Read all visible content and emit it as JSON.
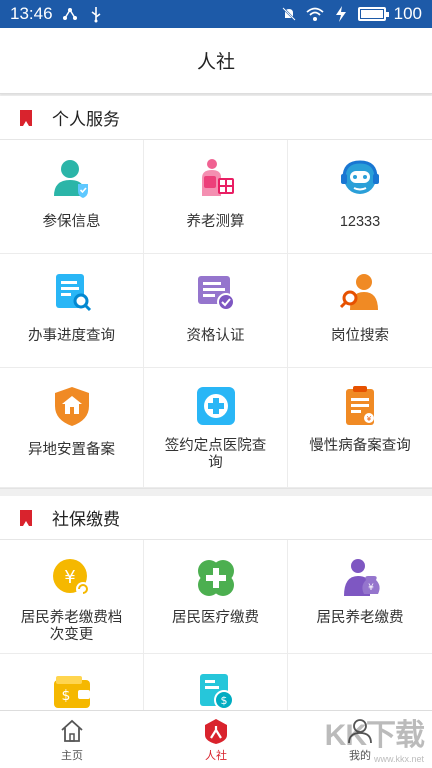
{
  "statusbar": {
    "time": "13:46",
    "battery_text": "100",
    "battery_level": 1.0
  },
  "header": {
    "title": "人社"
  },
  "personal": {
    "title": "个人服务",
    "items": [
      {
        "label": "参保信息",
        "icon": "insured-person-icon"
      },
      {
        "label": "养老测算",
        "icon": "pension-calculator-icon"
      },
      {
        "label": "12333",
        "icon": "hotline-robot-icon"
      },
      {
        "label": "办事进度查询",
        "icon": "progress-search-icon"
      },
      {
        "label": "资格认证",
        "icon": "qualification-verify-icon"
      },
      {
        "label": "岗位搜索",
        "icon": "job-search-icon"
      },
      {
        "label": "异地安置备案",
        "icon": "relocation-house-icon"
      },
      {
        "label": "签约定点医院查询",
        "icon": "hospital-cross-icon"
      },
      {
        "label": "慢性病备案查询",
        "icon": "chronic-clipboard-icon"
      }
    ]
  },
  "social": {
    "title": "社保缴费",
    "items": [
      {
        "label": "居民养老缴费档次变更",
        "icon": "yuan-coin-change-icon"
      },
      {
        "label": "居民医疗缴费",
        "icon": "medical-clover-icon"
      },
      {
        "label": "居民养老缴费",
        "icon": "elder-money-bag-icon"
      },
      {
        "label": "",
        "icon": "wallet-dollar-icon"
      },
      {
        "label": "",
        "icon": "cash-payment-icon"
      },
      {
        "label": "",
        "icon": ""
      }
    ]
  },
  "tabs": [
    {
      "label": "主页",
      "icon": "home-icon"
    },
    {
      "label": "人社",
      "icon": "renshe-icon"
    },
    {
      "label": "我的",
      "icon": "profile-icon"
    }
  ],
  "watermark": {
    "text": "KK下载",
    "sub": "www.kkx.net"
  },
  "colors": {
    "statusbar": "#1d5aa8",
    "accent_red": "#d9232d",
    "teal": "#2bb5a8",
    "pink": "#f06292",
    "blue": "#2a9fd8",
    "purple": "#7e57c2",
    "orange": "#f08a24",
    "green": "#4caf50",
    "yellow": "#f5b800"
  }
}
